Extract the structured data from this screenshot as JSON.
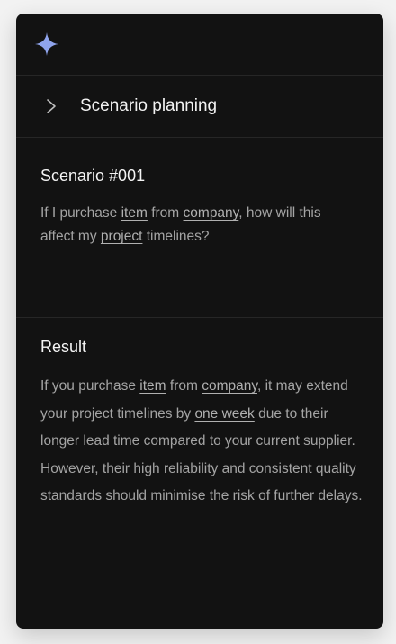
{
  "icons": {
    "logo": "sparkle-icon",
    "nav_chevron": "chevron-right-icon"
  },
  "colors": {
    "accent": "#8fa4ec",
    "panel": "#121212",
    "text_primary": "#f2f2f2",
    "text_secondary": "#a4a4a4"
  },
  "nav": {
    "label": "Scenario planning"
  },
  "scenario": {
    "title": "Scenario #001",
    "query": {
      "p1": "If I purchase ",
      "item": "item",
      "p2": " from ",
      "company": "company",
      "p3": ", how will this affect my ",
      "project": "project",
      "p4": " timelines?"
    }
  },
  "result": {
    "title": "Result",
    "text": {
      "p1": "If you purchase ",
      "item": "item",
      "p2": " from ",
      "company": "company",
      "p3": ", it may extend your project timelines by ",
      "duration": "one week",
      "p4": " due to their longer lead time compared to your current supplier. However, their high reliability and consistent quality standards should minimise the risk of further delays."
    }
  }
}
